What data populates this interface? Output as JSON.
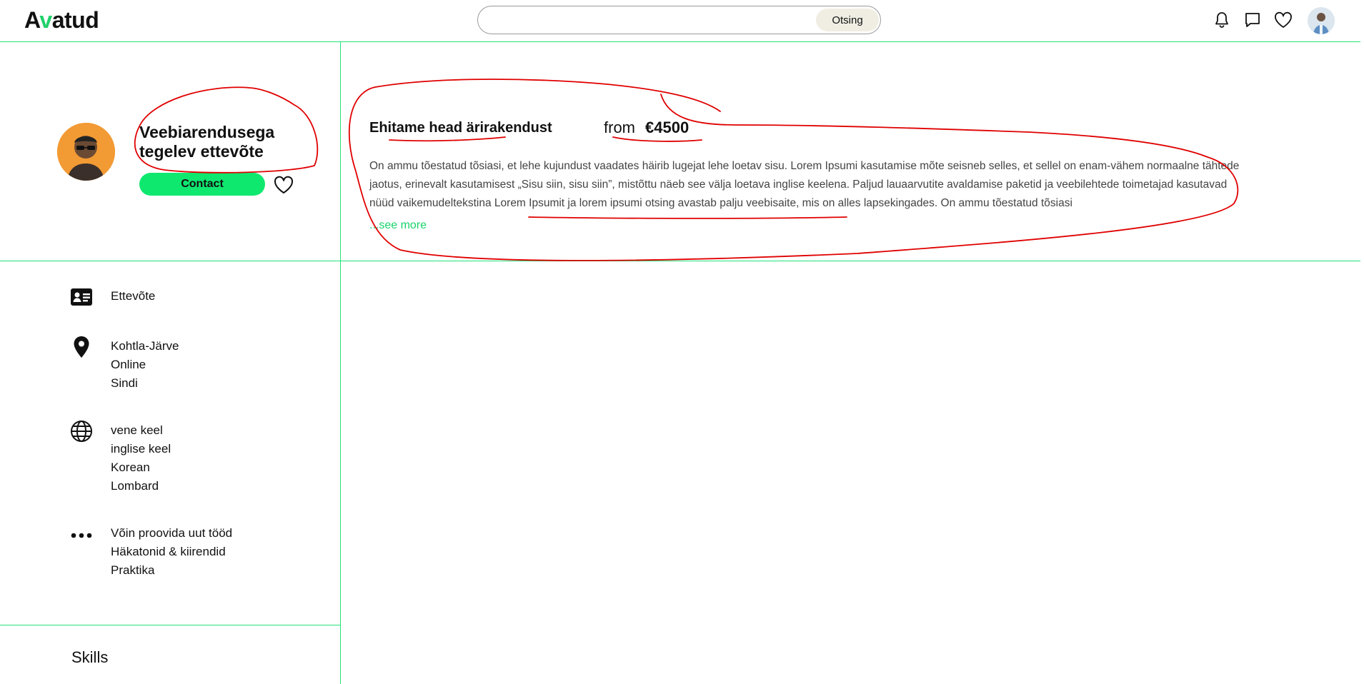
{
  "header": {
    "logo": {
      "pre": "A",
      "mid": "v",
      "post": "atud"
    },
    "search": {
      "placeholder": "",
      "button_label": "Otsing"
    },
    "icons": [
      "bell-icon",
      "chat-icon",
      "heart-icon"
    ]
  },
  "profile": {
    "name_line1": "Veebiarendusega",
    "name_line2": "tegelev ettevõte",
    "contact_label": "Contact"
  },
  "service": {
    "title": "Ehitame head ärirakendust",
    "price_prefix": "from",
    "price_amount": "€4500",
    "description": "On ammu tõestatud tõsiasi, et lehe kujundust vaadates häirib lugejat lehe loetav sisu. Lorem Ipsumi kasutamise mõte seisneb selles, et sellel on enam-vähem normaalne tähtede jaotus, erinevalt kasutamisest „Sisu siin, sisu siin”, mistõttu näeb see välja loetava inglise keelena. Paljud lauaarvutite avaldamise paketid ja veebilehtede toimetajad kasutavad nüüd vaikemudeltekstina Lorem Ipsumit ja lorem ipsumi otsing avastab palju veebisaite, mis on alles lapsekingades. On ammu tõestatud tõsiasi",
    "see_more": "...see more"
  },
  "info": {
    "type": {
      "icon": "id-card-icon",
      "items": [
        "Ettevõte"
      ]
    },
    "locations": {
      "icon": "location-pin-icon",
      "items": [
        "Kohtla-Järve",
        "Online",
        "Sindi"
      ]
    },
    "languages": {
      "icon": "globe-icon",
      "items": [
        "vene keel",
        "inglise keel",
        "Korean",
        "Lombard"
      ]
    },
    "other": {
      "icon": "more-dots-icon",
      "items": [
        "Võin proovida uut tööd",
        "Häkatonid & kiirendid",
        "Praktika"
      ]
    }
  },
  "skills_heading": "Skills",
  "colors": {
    "accent": "#0fe86f",
    "divider": "#23e27a",
    "annotation": "#e00000"
  }
}
